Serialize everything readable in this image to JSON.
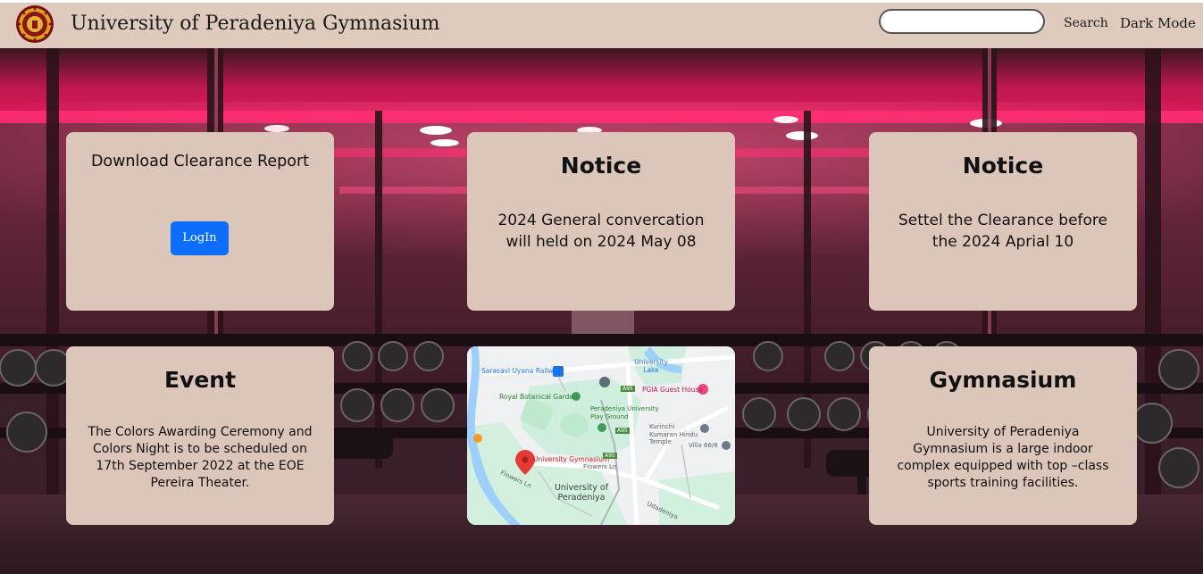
{
  "header": {
    "brand_title": "University of Peradeniya Gymnasium",
    "search_placeholder": "",
    "search_button": "Search",
    "dark_mode_button": "Dark Mode"
  },
  "cards": {
    "clearance": {
      "title": "Download Clearance Report",
      "button": "LogIn"
    },
    "notice1": {
      "title": "Notice",
      "body": "2024 General convercation will held on 2024 May 08"
    },
    "notice2": {
      "title": "Notice",
      "body": "Settel the Clearance before the 2024 Aprial 10"
    },
    "event": {
      "title": "Event",
      "body": "The Colors Awarding Ceremony and Colors Night is to be scheduled on 17th September 2022 at the EOE Pereira Theater."
    },
    "gymnasium": {
      "title": "Gymnasium",
      "body": "University of Peradeniya Gymnasium is a large indoor complex equipped with top –class sports training facilities."
    }
  },
  "map": {
    "labels": {
      "railway": "Sarasavi Uyana Railway",
      "lake": "University Lake",
      "botanical": "Royal Botanical Garden",
      "guest_house": "PGIA Guest House",
      "play_ground": "Peradeniya University Play Ground",
      "kovil": "Kurinchi Kumaran Hindu Temple",
      "gymnasium": "University Gymnasium",
      "flowers_ln": "Flowers Ln",
      "flowers_ln2": "Flowers Ln",
      "university": "University of Peradeniya",
      "villa": "Villa 66/8",
      "road_badge1": "A95",
      "road_badge2": "A95",
      "road_badge3": "A95",
      "upadeniya": "Udadeniya"
    }
  },
  "colors": {
    "header_bg": "#dfcbbd",
    "card_bg": "#dcc6b9",
    "login_button": "#0d6efd",
    "accent_pink": "#e0185a"
  }
}
